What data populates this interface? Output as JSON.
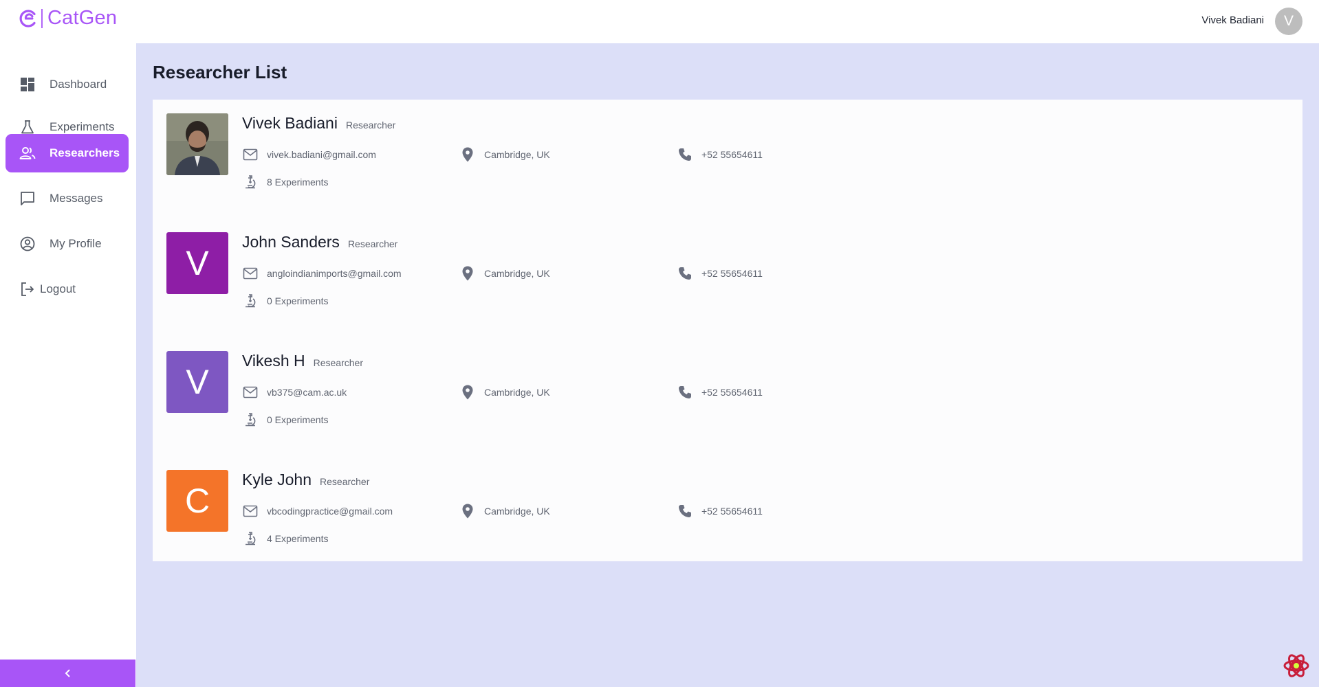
{
  "app": {
    "name": "CatGen",
    "brand_color": "#a855f7"
  },
  "header": {
    "user_name": "Vivek Badiani",
    "user_initial": "V"
  },
  "sidebar": {
    "items": [
      {
        "label": "Dashboard",
        "icon": "dashboard-icon",
        "active": false
      },
      {
        "label": "Experiments",
        "icon": "flask-icon",
        "active": false
      },
      {
        "label": "Researchers",
        "icon": "people-icon",
        "active": true
      },
      {
        "label": "Messages",
        "icon": "chat-icon",
        "active": false
      },
      {
        "label": "My Profile",
        "icon": "profile-icon",
        "active": false
      },
      {
        "label": "Logout",
        "icon": "logout-icon",
        "active": false
      }
    ],
    "collapse_icon": "chevron-left-icon"
  },
  "main": {
    "title": "Researcher List",
    "researchers": [
      {
        "name": "Vivek Badiani",
        "role": "Researcher",
        "avatar": "photo",
        "avatar_color": "#6b6f5f",
        "email": "vivek.badiani@gmail.com",
        "location": "Cambridge, UK",
        "phone": "+52 55654611",
        "experiments": "8 Experiments"
      },
      {
        "name": "John Sanders",
        "role": "Researcher",
        "avatar": "V",
        "avatar_color": "#8e1ea6",
        "email": "angloindianimports@gmail.com",
        "location": "Cambridge, UK",
        "phone": "+52 55654611",
        "experiments": "0 Experiments"
      },
      {
        "name": "Vikesh H",
        "role": "Researcher",
        "avatar": "V",
        "avatar_color": "#7e57c2",
        "email": "vb375@cam.ac.uk",
        "location": "Cambridge, UK",
        "phone": "+52 55654611",
        "experiments": "0 Experiments"
      },
      {
        "name": "Kyle John",
        "role": "Researcher",
        "avatar": "C",
        "avatar_color": "#f47429",
        "email": "vbcodingpractice@gmail.com",
        "location": "Cambridge, UK",
        "phone": "+52 55654611",
        "experiments": "4 Experiments"
      }
    ]
  }
}
